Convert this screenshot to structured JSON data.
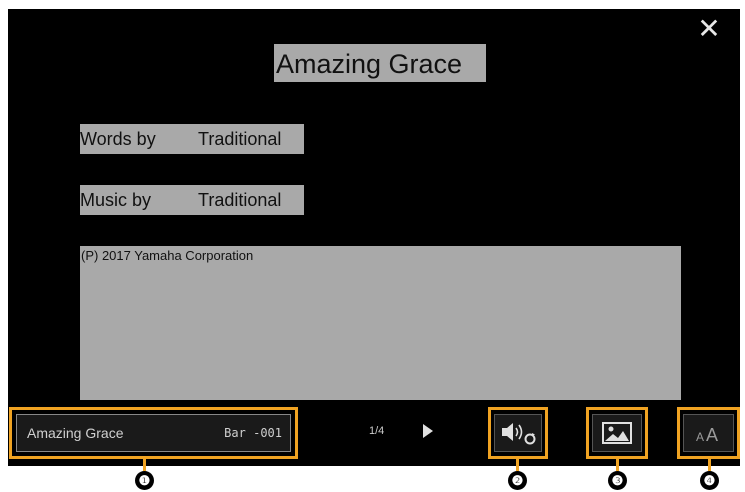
{
  "screen": {
    "close_icon": "close-icon",
    "song_title": "Amazing Grace",
    "words_label": "Words by",
    "words_value": "Traditional",
    "music_label": "Music by",
    "music_value": "Traditional",
    "copyright": "(P) 2017 Yamaha Corporation"
  },
  "toolbar": {
    "song_name": "Amazing Grace",
    "bar_label": "Bar",
    "bar_value": "-001",
    "page": "1/4",
    "next_icon": "play-right-icon",
    "audio_icon": "speaker-repeat-icon",
    "image_icon": "image-icon",
    "font_icon": "font-size-icon"
  },
  "callouts": [
    "❶",
    "❷",
    "❸",
    "❹"
  ],
  "colors": {
    "callout": "#f0a322",
    "highlight": "#a9a9a9",
    "screen_bg": "#000000"
  }
}
